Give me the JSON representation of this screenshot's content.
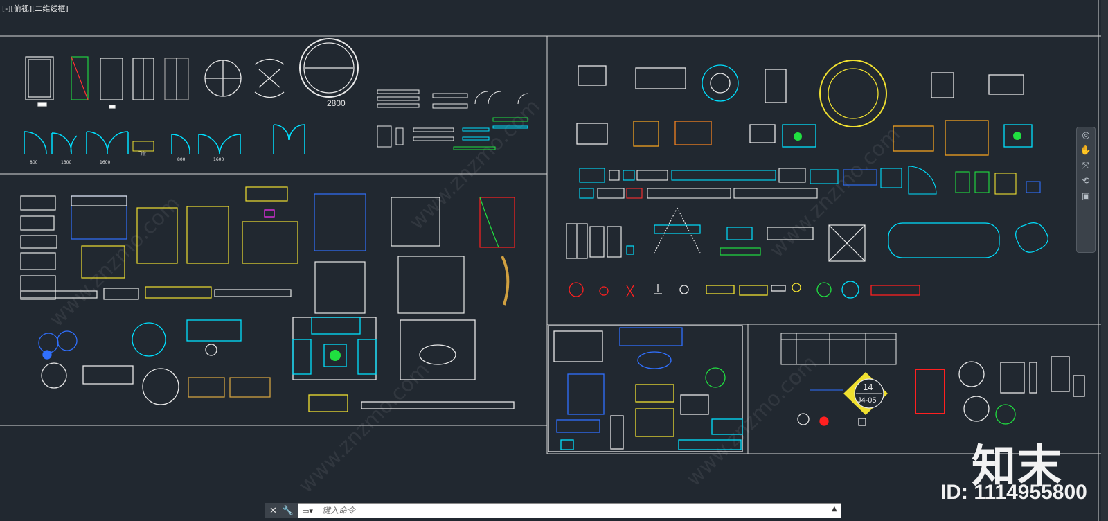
{
  "viewport": {
    "view_label": "[-][俯视][二维线框]",
    "background": "#212830"
  },
  "drawing": {
    "door_width_labels": [
      "800",
      "1300",
      "1600",
      "800",
      "1600"
    ],
    "door_tag": "门套",
    "round_door_label": "2800",
    "room_tag_number": "14",
    "room_tag_code": "J4-05"
  },
  "colors": {
    "cyan": "#00e0ff",
    "yellow": "#f0e030",
    "orange": "#ff9020",
    "white": "#e8e8e8",
    "red": "#ff2020",
    "blue": "#3070ff",
    "green": "#20e040",
    "magenta": "#ff30ff",
    "gold": "#d0a040"
  },
  "command_line": {
    "close_icon": "close-icon",
    "settings_icon": "wrench-icon",
    "prompt_icon": "command-prompt-icon",
    "placeholder": "键入命令",
    "expand_icon": "chevron-up-icon"
  },
  "nav_bar": {
    "icons": [
      "steering-wheel-icon",
      "pan-hand-icon",
      "zoom-extents-icon",
      "orbit-icon",
      "showmotion-icon"
    ]
  },
  "brand": {
    "mark": "知末",
    "id_text": "ID: 1114955800",
    "watermark": "www.znzmo.com"
  }
}
